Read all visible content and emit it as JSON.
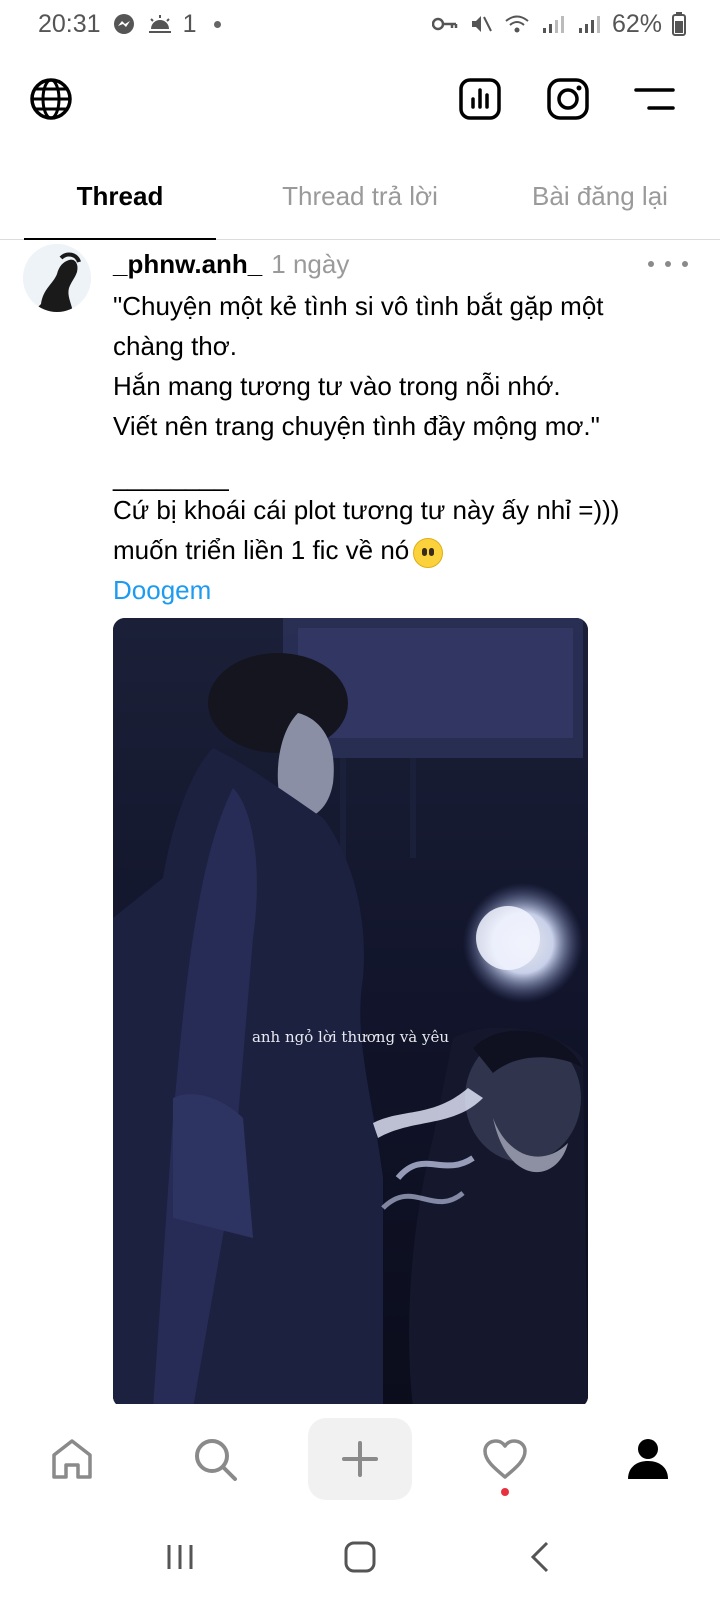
{
  "status_bar": {
    "time": "20:31",
    "extra": "1",
    "battery": "62%"
  },
  "tabs": [
    {
      "label": "Thread"
    },
    {
      "label": "Thread trả lời"
    },
    {
      "label": "Bài đăng lại"
    }
  ],
  "post": {
    "username": "_phnw.anh_",
    "time": "1 ngày",
    "lines": [
      "\"Chuyện một kẻ tình si vô tình bắt gặp một",
      "chàng thơ.",
      "Hắn mang tương tư vào trong nỗi nhớ.",
      "Viết nên trang chuyện tình đầy mộng mơ.\"",
      "________",
      "Cứ bị khoái cái plot tương tư này ấy nhỉ =)))",
      "muốn triển liền 1 fic về nó"
    ],
    "tag": "Doogem",
    "media_caption": "anh ngỏ lời thương và yêu"
  },
  "icons": {
    "globe": "globe-icon",
    "insights": "bar-chart-icon",
    "instagram": "instagram-icon",
    "menu": "menu-icon",
    "home": "home-icon",
    "search": "search-icon",
    "compose": "plus-icon",
    "activity": "heart-icon",
    "profile": "profile-icon"
  },
  "colors": {
    "link": "#1d9bf0",
    "muted": "#9a9a9a",
    "notification": "#e8313f"
  }
}
